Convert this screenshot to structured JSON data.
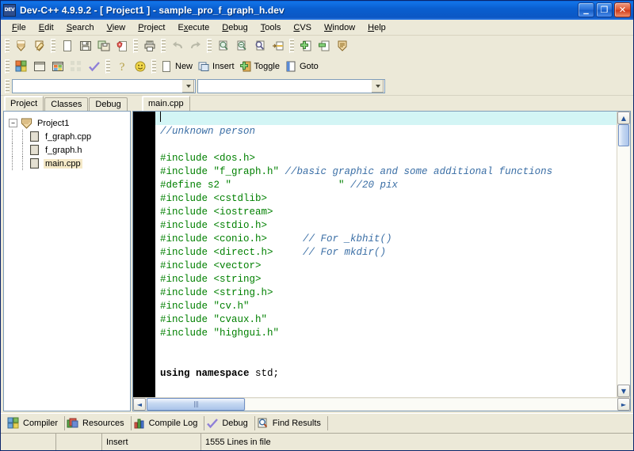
{
  "window": {
    "app_name": "Dev-C++",
    "version": "4.9.9.2",
    "title": "Dev-C++ 4.9.9.2  -  [ Project1 ] - sample_pro_f_graph_h.dev",
    "icon": "dev-app-icon",
    "minimize_label": "_",
    "restore_label": "❐",
    "close_label": "✕"
  },
  "menubar": {
    "items": [
      {
        "label": "File",
        "accel": "F"
      },
      {
        "label": "Edit",
        "accel": "E"
      },
      {
        "label": "Search",
        "accel": "S"
      },
      {
        "label": "View",
        "accel": "V"
      },
      {
        "label": "Project",
        "accel": "P"
      },
      {
        "label": "Execute",
        "accel": "x"
      },
      {
        "label": "Debug",
        "accel": "D"
      },
      {
        "label": "Tools",
        "accel": "T"
      },
      {
        "label": "CVS",
        "accel": "C"
      },
      {
        "label": "Window",
        "accel": "W"
      },
      {
        "label": "Help",
        "accel": "H"
      }
    ]
  },
  "toolbar_row1": {
    "groups": [
      {
        "buttons": [
          {
            "name": "new-project-icon",
            "tip": "New project"
          },
          {
            "name": "open-project-icon",
            "tip": "Open project"
          }
        ]
      },
      {
        "buttons": [
          {
            "name": "new-file-icon",
            "tip": "New source file"
          },
          {
            "name": "save-icon",
            "tip": "Save"
          },
          {
            "name": "save-all-icon",
            "tip": "Save all"
          },
          {
            "name": "close-file-icon",
            "tip": "Close"
          }
        ]
      },
      {
        "buttons": [
          {
            "name": "print-icon",
            "tip": "Print"
          }
        ]
      },
      {
        "buttons": [
          {
            "name": "undo-icon",
            "tip": "Undo"
          },
          {
            "name": "redo-icon",
            "tip": "Redo"
          }
        ]
      },
      {
        "buttons": [
          {
            "name": "find-icon",
            "tip": "Find"
          },
          {
            "name": "find-next-icon",
            "tip": "Find next"
          },
          {
            "name": "replace-icon",
            "tip": "Replace"
          },
          {
            "name": "goto-line-icon",
            "tip": "Goto line"
          }
        ]
      },
      {
        "buttons": [
          {
            "name": "add-to-project-icon",
            "tip": "Add to project"
          },
          {
            "name": "remove-from-project-icon",
            "tip": "Remove from project"
          },
          {
            "name": "project-options-icon",
            "tip": "Project options"
          }
        ]
      }
    ]
  },
  "toolbar_row2": {
    "groups": [
      {
        "buttons": [
          {
            "name": "compile-icon",
            "tip": "Compile"
          },
          {
            "name": "run-icon",
            "tip": "Run"
          },
          {
            "name": "compile-run-icon",
            "tip": "Compile and run"
          },
          {
            "name": "rebuild-all-icon",
            "tip": "Rebuild all"
          },
          {
            "name": "syntax-check-icon",
            "tip": "Syntax check"
          }
        ]
      },
      {
        "buttons": [
          {
            "name": "help-icon",
            "tip": "Help"
          },
          {
            "name": "about-icon",
            "tip": "About"
          }
        ]
      }
    ],
    "labeled": [
      {
        "name": "new-bookmark-button",
        "icon": "page-icon",
        "label": "New"
      },
      {
        "name": "insert-button",
        "icon": "insert-icon",
        "label": "Insert"
      },
      {
        "name": "toggle-button",
        "icon": "toggle-icon",
        "label": "Toggle"
      },
      {
        "name": "goto-button",
        "icon": "goto-icon",
        "label": "Goto"
      }
    ]
  },
  "combos": {
    "class_browser": {
      "value": "",
      "placeholder": ""
    },
    "member_browser": {
      "value": "",
      "placeholder": ""
    }
  },
  "left_panel": {
    "tabs": [
      {
        "label": "Project",
        "active": true
      },
      {
        "label": "Classes",
        "active": false
      },
      {
        "label": "Debug",
        "active": false
      }
    ],
    "tree": {
      "root": {
        "label": "Project1",
        "expander": "−",
        "icon": "project-icon"
      },
      "children": [
        {
          "label": "f_graph.cpp",
          "icon": "source-file-icon",
          "selected": false
        },
        {
          "label": "f_graph.h",
          "icon": "header-file-icon",
          "selected": false
        },
        {
          "label": "main.cpp",
          "icon": "source-file-icon",
          "selected": true
        }
      ]
    }
  },
  "editor": {
    "tabs": [
      {
        "label": "main.cpp",
        "active": true
      }
    ],
    "lines": [
      {
        "n": 1,
        "current": true,
        "tokens": [
          {
            "t": "",
            "c": "plain"
          }
        ]
      },
      {
        "n": 2,
        "current": false,
        "tokens": [
          {
            "t": "//unknown person",
            "c": "cmt"
          }
        ]
      },
      {
        "n": 3,
        "current": false,
        "tokens": [
          {
            "t": "",
            "c": "plain"
          }
        ]
      },
      {
        "n": 4,
        "current": false,
        "tokens": [
          {
            "t": "#include <dos.h>",
            "c": "kw"
          }
        ]
      },
      {
        "n": 5,
        "current": false,
        "tokens": [
          {
            "t": "#include \"f_graph.h\" ",
            "c": "kw"
          },
          {
            "t": "//basic graphic and some additional functions",
            "c": "cmt"
          }
        ]
      },
      {
        "n": 6,
        "current": false,
        "tokens": [
          {
            "t": "#define s2 \"                  \" ",
            "c": "kw"
          },
          {
            "t": "//20 pix",
            "c": "cmt"
          }
        ]
      },
      {
        "n": 7,
        "current": false,
        "tokens": [
          {
            "t": "#include <cstdlib>",
            "c": "kw"
          }
        ]
      },
      {
        "n": 8,
        "current": false,
        "tokens": [
          {
            "t": "#include <iostream>",
            "c": "kw"
          }
        ]
      },
      {
        "n": 9,
        "current": false,
        "tokens": [
          {
            "t": "#include <stdio.h>",
            "c": "kw"
          }
        ]
      },
      {
        "n": 10,
        "current": false,
        "tokens": [
          {
            "t": "#include <conio.h>      ",
            "c": "kw"
          },
          {
            "t": "// For _kbhit()",
            "c": "cmt"
          }
        ]
      },
      {
        "n": 11,
        "current": false,
        "tokens": [
          {
            "t": "#include <direct.h>     ",
            "c": "kw"
          },
          {
            "t": "// For mkdir()",
            "c": "cmt"
          }
        ]
      },
      {
        "n": 12,
        "current": false,
        "tokens": [
          {
            "t": "#include <vector>",
            "c": "kw"
          }
        ]
      },
      {
        "n": 13,
        "current": false,
        "tokens": [
          {
            "t": "#include <string>",
            "c": "kw"
          }
        ]
      },
      {
        "n": 14,
        "current": false,
        "tokens": [
          {
            "t": "#include <string.h>",
            "c": "kw"
          }
        ]
      },
      {
        "n": 15,
        "current": false,
        "tokens": [
          {
            "t": "#include \"cv.h\"",
            "c": "kw"
          }
        ]
      },
      {
        "n": 16,
        "current": false,
        "tokens": [
          {
            "t": "#include \"cvaux.h\"",
            "c": "kw"
          }
        ]
      },
      {
        "n": 17,
        "current": false,
        "tokens": [
          {
            "t": "#include \"highgui.h\"",
            "c": "kw"
          }
        ]
      },
      {
        "n": 18,
        "current": false,
        "tokens": [
          {
            "t": "",
            "c": "plain"
          }
        ]
      },
      {
        "n": 19,
        "current": false,
        "tokens": [
          {
            "t": "",
            "c": "plain"
          }
        ]
      },
      {
        "n": 20,
        "current": false,
        "tokens": [
          {
            "t": "using namespace ",
            "c": "key"
          },
          {
            "t": "std;",
            "c": "plain"
          }
        ]
      }
    ]
  },
  "bottom_tabs": [
    {
      "label": "Compiler",
      "icon": "compiler-icon"
    },
    {
      "label": "Resources",
      "icon": "resources-icon"
    },
    {
      "label": "Compile Log",
      "icon": "compile-log-icon"
    },
    {
      "label": "Debug",
      "icon": "debug-check-icon"
    },
    {
      "label": "Find Results",
      "icon": "find-results-icon"
    }
  ],
  "statusbar": {
    "cell1": "",
    "cell2": "",
    "mode": "Insert",
    "lines": "1555 Lines in file"
  },
  "colors": {
    "title_bar": "#0b57c4",
    "chrome": "#ece9d8",
    "preprocessor": "#008000",
    "comment": "#3a6ea5",
    "current_line": "#d3f5f5",
    "gutter": "#000000",
    "selection": "#f5e9c8"
  }
}
